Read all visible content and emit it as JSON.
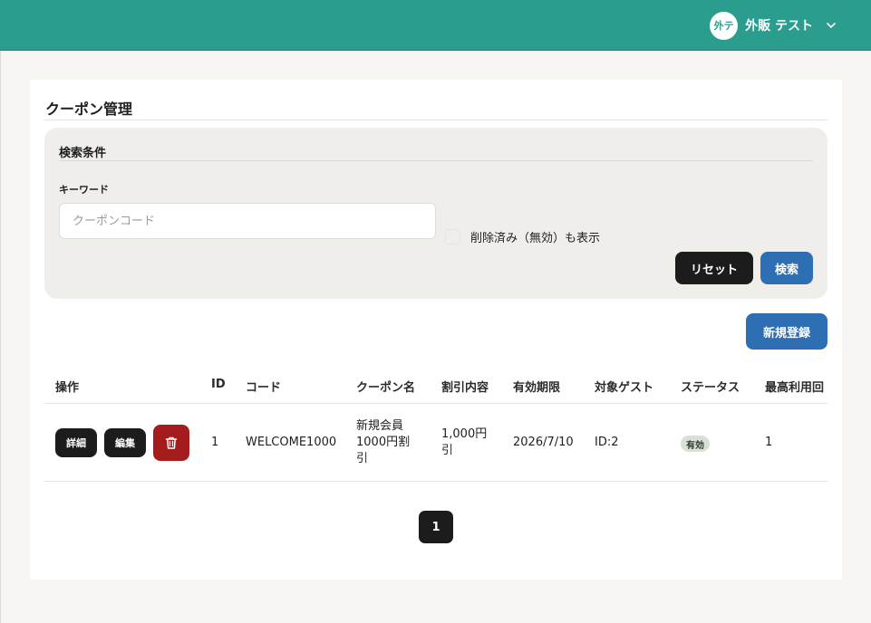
{
  "header": {
    "avatar_text": "外テ",
    "user_name": "外販 テスト",
    "menu_icon": "chevron-down-icon",
    "bg_color": "#2a9d8f"
  },
  "page": {
    "title": "クーポン管理"
  },
  "search": {
    "panel_title": "検索条件",
    "keyword_label": "キーワード",
    "keyword_placeholder": "クーポンコード",
    "keyword_value": "",
    "show_deleted_label": "削除済み（無効）も表示",
    "show_deleted_checked": false,
    "reset_label": "リセット",
    "search_label": "検索"
  },
  "actions": {
    "new_label": "新規登録"
  },
  "table": {
    "columns": [
      "操作",
      "ID",
      "コード",
      "クーポン名",
      "割引内容",
      "有効期限",
      "対象ゲスト",
      "ステータス",
      "最高利用回"
    ],
    "rows": [
      {
        "detail_label": "詳細",
        "edit_label": "編集",
        "delete_icon": "trash-icon",
        "id": "1",
        "code": "WELCOME1000",
        "name_lines": [
          "新規会員",
          "1000円割",
          "引"
        ],
        "discount_lines": [
          "1,000円",
          "引"
        ],
        "expiry": "2026/7/10",
        "target": "ID:2",
        "status": "有効",
        "max_uses": "1"
      }
    ]
  },
  "pagination": {
    "current_page": "1"
  },
  "colors": {
    "primary": "#2e6fb3",
    "dark": "#1c1c1c",
    "danger": "#a51c1c",
    "status_active_bg": "#d9e0d5"
  }
}
